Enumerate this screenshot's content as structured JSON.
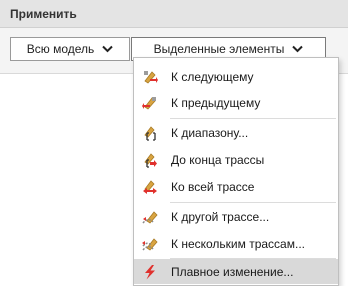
{
  "header": {
    "title": "Применить"
  },
  "toolbar": {
    "all_model_label": "Всю модель",
    "selected_label": "Выделенные элементы"
  },
  "menu": {
    "items": [
      {
        "label": "К следующему",
        "icon": "next-icon"
      },
      {
        "label": "К предыдущему",
        "icon": "previous-icon"
      },
      {
        "label": "К диапазону...",
        "icon": "range-icon"
      },
      {
        "label": "До конца трассы",
        "icon": "to-end-icon"
      },
      {
        "label": "Ко всей трассе",
        "icon": "whole-route-icon"
      },
      {
        "label": "К другой трассе...",
        "icon": "other-route-icon"
      },
      {
        "label": "К нескольким трассам...",
        "icon": "several-routes-icon"
      },
      {
        "label": "Плавное изменение...",
        "icon": "lightning-icon"
      }
    ]
  },
  "colors": {
    "accent_red": "#e0312d",
    "icon_gold": "#d9a441",
    "highlight": "#d9d9d9"
  }
}
